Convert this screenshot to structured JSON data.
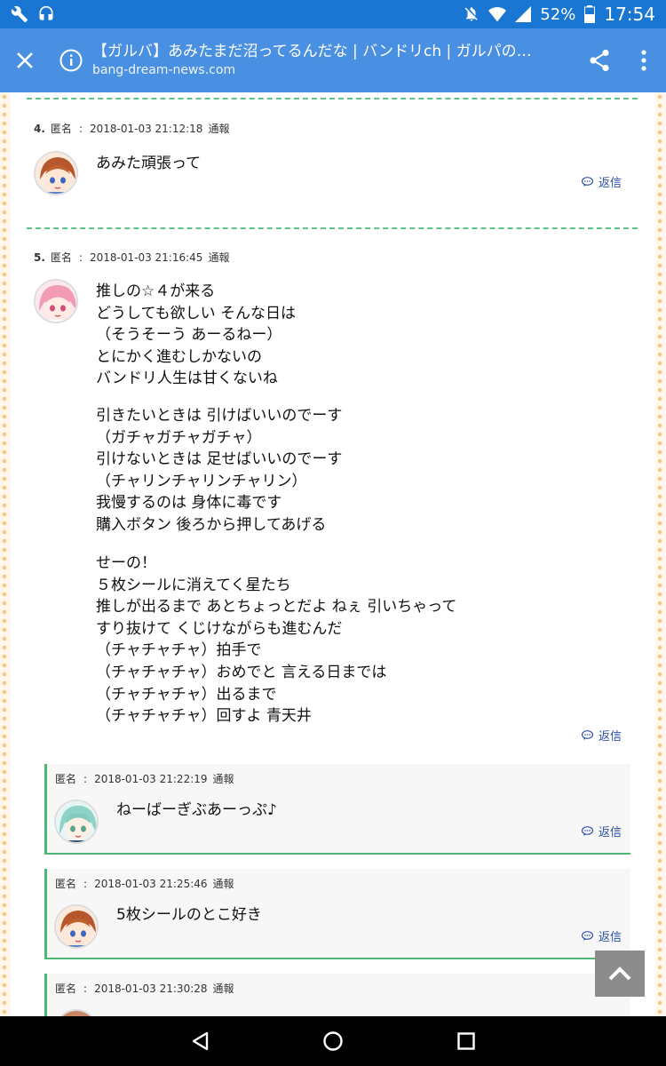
{
  "status_bar": {
    "battery": "52%",
    "time": "17:54"
  },
  "toolbar": {
    "title": "【ガルバ】あみたまだ沼ってるんだな | バンドリch | ガルパの…",
    "url": "bang-dream-news.com"
  },
  "comments": [
    {
      "number": "4.",
      "author": "匿名",
      "sep": ":",
      "timestamp": "2018-01-03 21:12:18",
      "report": "通報",
      "text": "あみた頑張って",
      "reply": "返信"
    },
    {
      "number": "5.",
      "author": "匿名",
      "sep": ":",
      "timestamp": "2018-01-03 21:16:45",
      "report": "通報",
      "text_blocks": [
        "推しの☆４が来る\nどうしても欲しい そんな日は\n（そうそーう あーるねー）\nとにかく進むしかないの\nバンドリ人生は甘くないね",
        "引きたいときは 引けばいいのでーす\n（ガチャガチャガチャ）\n引けないときは 足せばいいのでーす\n（チャリンチャリンチャリン）\n我慢するのは 身体に毒です\n購入ボタン 後ろから押してあげる",
        "せーの！\n５枚シールに消えてく星たち\n推しが出るまで あとちょっとだよ ねぇ 引いちゃって\nすり抜けて くじけながらも進むんだ\n（チャチャチャ）拍手で\n（チャチャチャ）おめでと 言える日までは\n（チャチャチャ）出るまで\n（チャチャチャ）回すよ 青天井"
      ],
      "reply": "返信"
    }
  ],
  "replies": [
    {
      "author": "匿名",
      "sep": ":",
      "timestamp": "2018-01-03 21:22:19",
      "report": "通報",
      "text": "ねーばーぎぶあーっぷ♪",
      "reply": "返信"
    },
    {
      "author": "匿名",
      "sep": ":",
      "timestamp": "2018-01-03 21:25:46",
      "report": "通報",
      "text": "5枚シールのとこ好き",
      "reply": "返信"
    },
    {
      "author": "匿名",
      "sep": ":",
      "timestamp": "2018-01-03 21:30:28",
      "report": "通報",
      "text": "",
      "reply": ""
    }
  ],
  "colors": {
    "status_bar": "#1976d2",
    "toolbar": "#4a90e2",
    "divider": "#5cc08a",
    "reply_link": "#2a4fa3"
  }
}
